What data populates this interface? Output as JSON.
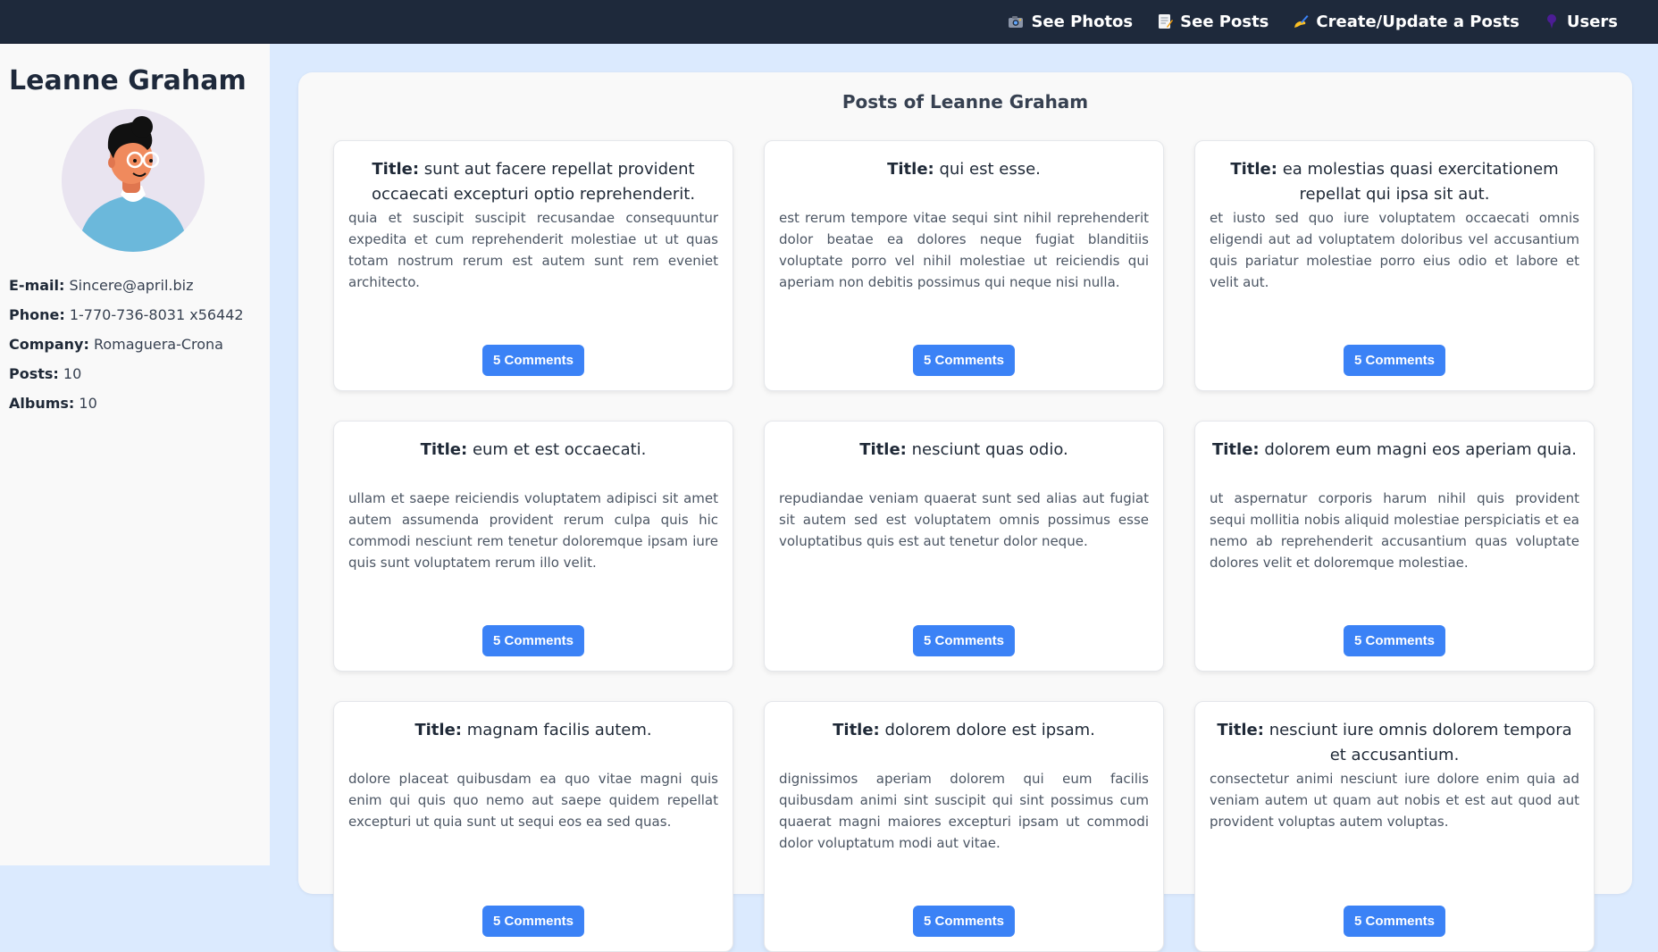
{
  "nav": {
    "items": [
      {
        "label": "See Photos",
        "icon": "camera-icon"
      },
      {
        "label": "See Posts",
        "icon": "memo-icon"
      },
      {
        "label": "Create/Update a Posts",
        "icon": "writing-hand-icon"
      },
      {
        "label": "Users",
        "icon": "user-pin-icon"
      }
    ]
  },
  "user": {
    "name": "Leanne Graham",
    "email_label": "E-mail:",
    "email": "Sincere@april.biz",
    "phone_label": "Phone:",
    "phone": "1-770-736-8031 x56442",
    "company_label": "Company:",
    "company": "Romaguera-Crona",
    "posts_label": "Posts:",
    "posts": "10",
    "albums_label": "Albums:",
    "albums": "10"
  },
  "main": {
    "title": "Posts of Leanne Graham",
    "title_prefix": "Title:",
    "posts": [
      {
        "title": "sunt aut facere repellat provident occaecati excepturi optio reprehenderit.",
        "body": "quia et suscipit suscipit recusandae consequuntur expedita et cum reprehenderit molestiae ut ut quas totam nostrum rerum est autem sunt rem eveniet architecto.",
        "comments": "5 Comments"
      },
      {
        "title": "qui est esse.",
        "body": "est rerum tempore vitae sequi sint nihil reprehenderit dolor beatae ea dolores neque fugiat blanditiis voluptate porro vel nihil molestiae ut reiciendis qui aperiam non debitis possimus qui neque nisi nulla.",
        "comments": "5 Comments"
      },
      {
        "title": "ea molestias quasi exercitationem repellat qui ipsa sit aut.",
        "body": "et iusto sed quo iure voluptatem occaecati omnis eligendi aut ad voluptatem doloribus vel accusantium quis pariatur molestiae porro eius odio et labore et velit aut.",
        "comments": "5 Comments"
      },
      {
        "title": "eum et est occaecati.",
        "body": "ullam et saepe reiciendis voluptatem adipisci sit amet autem assumenda provident rerum culpa quis hic commodi nesciunt rem tenetur doloremque ipsam iure quis sunt voluptatem rerum illo velit.",
        "comments": "5 Comments"
      },
      {
        "title": "nesciunt quas odio.",
        "body": "repudiandae veniam quaerat sunt sed alias aut fugiat sit autem sed est voluptatem omnis possimus esse voluptatibus quis est aut tenetur dolor neque.",
        "comments": "5 Comments"
      },
      {
        "title": "dolorem eum magni eos aperiam quia.",
        "body": "ut aspernatur corporis harum nihil quis provident sequi mollitia nobis aliquid molestiae perspiciatis et ea nemo ab reprehenderit accusantium quas voluptate dolores velit et doloremque molestiae.",
        "comments": "5 Comments"
      },
      {
        "title": "magnam facilis autem.",
        "body": "dolore placeat quibusdam ea quo vitae magni quis enim qui quis quo nemo aut saepe quidem repellat excepturi ut quia sunt ut sequi eos ea sed quas.",
        "comments": "5 Comments"
      },
      {
        "title": "dolorem dolore est ipsam.",
        "body": "dignissimos aperiam dolorem qui eum facilis quibusdam animi sint suscipit qui sint possimus cum quaerat magni maiores excepturi ipsam ut commodi dolor voluptatum modi aut vitae.",
        "comments": "5 Comments"
      },
      {
        "title": "nesciunt iure omnis dolorem tempora et accusantium.",
        "body": "consectetur animi nesciunt iure dolore enim quia ad veniam autem ut quam aut nobis et est aut quod aut provident voluptas autem voluptas.",
        "comments": "5 Comments"
      }
    ]
  },
  "colors": {
    "nav_bg": "#1e293b",
    "accent": "#3b82f6",
    "page_bg": "#dbeafe"
  }
}
